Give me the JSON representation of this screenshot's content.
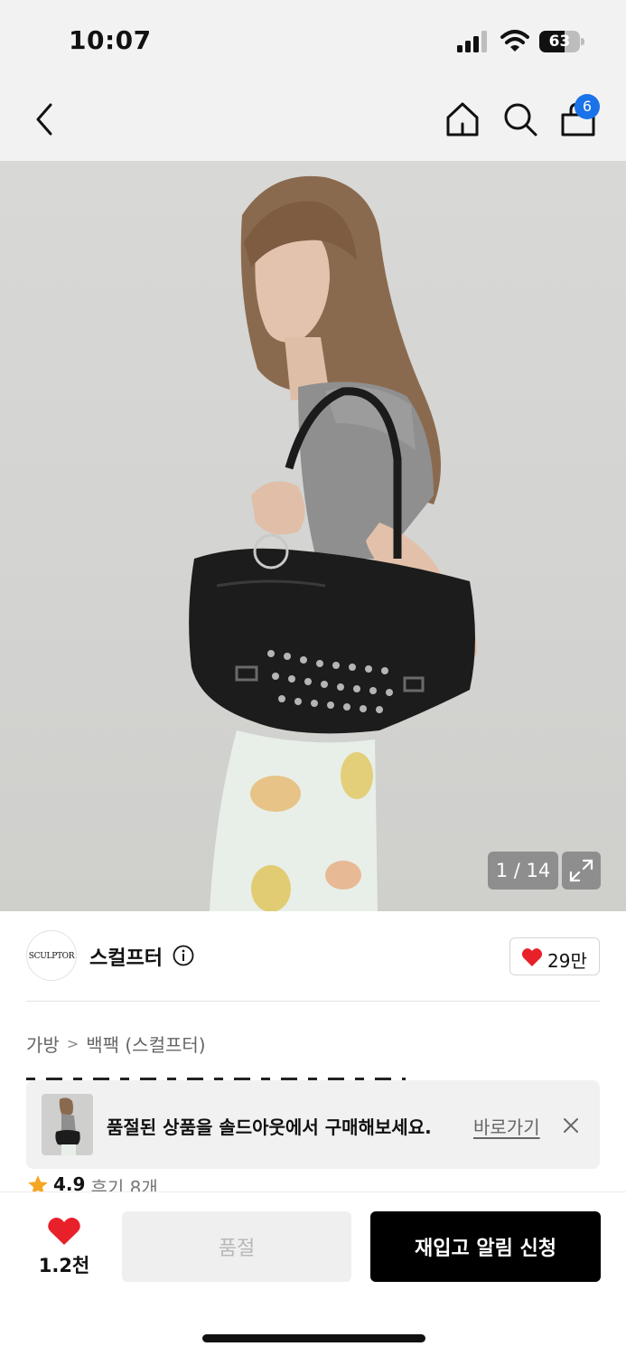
{
  "status_bar": {
    "time": "10:07",
    "battery": "63",
    "battery_level_percent": 63
  },
  "nav": {
    "cart_count": "6",
    "icons": [
      "back-chevron-icon",
      "home-icon",
      "search-icon",
      "shopping-bag-icon"
    ]
  },
  "gallery": {
    "counter": "1 / 14"
  },
  "brand": {
    "logo_text": "SCULPTOR",
    "name": "스컬프터",
    "likes": "29만"
  },
  "breadcrumb": {
    "category": "가방",
    "subcategory": "백팩 (스컬프터)"
  },
  "soldout_banner": {
    "message": "품절된 상품을 솔드아웃에서 구매해보세요.",
    "link_label": "바로가기"
  },
  "rating": {
    "score": "4.9",
    "reviews": "후기 8개"
  },
  "bottom_bar": {
    "wish_count": "1.2천",
    "soldout_label": "품절",
    "restock_label": "재입고 알림 신청"
  },
  "colors": {
    "accent_red": "#e8202a",
    "badge_blue": "#1a73e8",
    "primary_button": "#000000",
    "star_orange": "#f5a623"
  }
}
